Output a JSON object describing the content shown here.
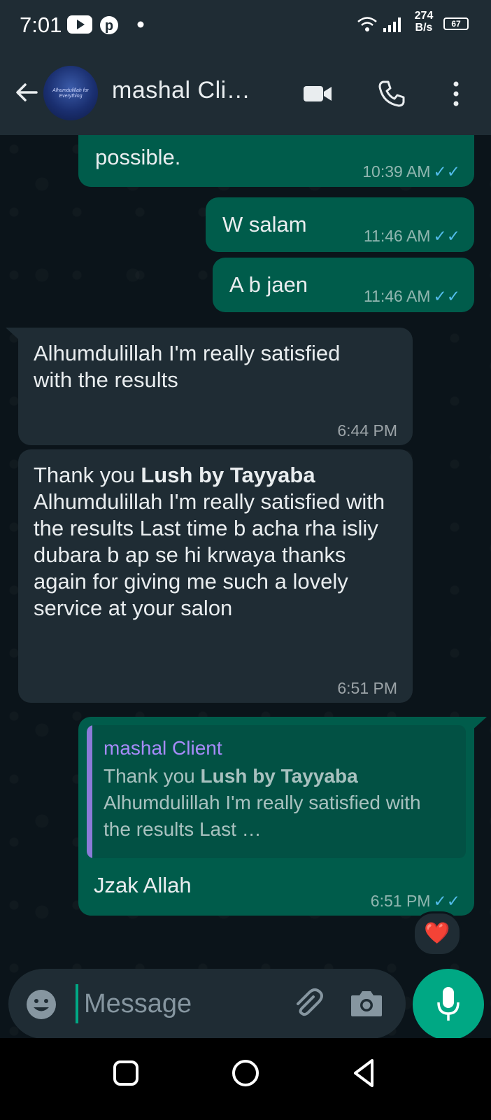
{
  "status_bar": {
    "time": "7:01",
    "net_speed_value": "274",
    "net_speed_unit": "B/s",
    "battery": "67"
  },
  "header": {
    "contact_name": "mashal Cli…",
    "avatar_text": "Alhumdulillah for Everything"
  },
  "messages": [
    {
      "text": "possible.",
      "time": "10:39 AM",
      "ticks": "✓✓"
    },
    {
      "text": "W salam",
      "time": "11:46 AM",
      "ticks": "✓✓"
    },
    {
      "text": "A b jaen",
      "time": "11:46 AM",
      "ticks": "✓✓"
    },
    {
      "text": "Alhumdulillah I'm really satisfied with the results",
      "time": "6:44 PM"
    },
    {
      "text_pre": "Thank you ",
      "text_bold": "Lush by Tayyaba",
      "text_post": " Alhumdulillah I'm really satisfied with the results Last time b acha rha isliy dubara b ap se hi krwaya thanks again for giving me such a lovely service at your salon",
      "time": "6:51 PM"
    },
    {
      "quote_name": "mashal Client",
      "quote_pre": "Thank you ",
      "quote_bold": "Lush by Tayyaba",
      "quote_post": " Alhumdulillah I'm really satisfied with the results Last …",
      "text": "Jzak Allah",
      "time": "6:51 PM",
      "ticks": "✓✓",
      "reaction": "❤️"
    }
  ],
  "composer": {
    "placeholder": "Message"
  },
  "colors": {
    "outgoing_bubble": "#005c4b",
    "incoming_bubble": "#1f2c34",
    "accent": "#00a884",
    "read_ticks": "#53bdeb"
  }
}
